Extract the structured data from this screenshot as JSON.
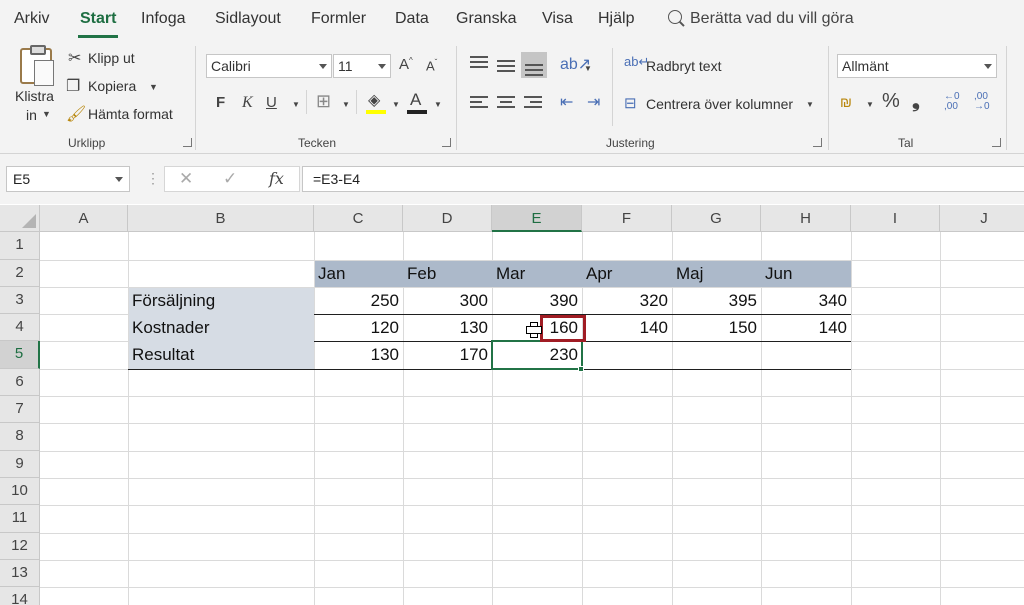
{
  "tabs": [
    "Arkiv",
    "Start",
    "Infoga",
    "Sidlayout",
    "Formler",
    "Data",
    "Granska",
    "Visa",
    "Hjälp"
  ],
  "tell_me": "Berätta vad du vill göra",
  "ribbon": {
    "clipboard": {
      "paste_line1": "Klistra",
      "paste_line2": "in",
      "cut": "Klipp ut",
      "copy": "Kopiera",
      "format_painter": "Hämta format",
      "group": "Urklipp"
    },
    "font": {
      "name": "Calibri",
      "size": "11",
      "bold": "F",
      "italic": "K",
      "underline": "U",
      "group": "Tecken"
    },
    "alignment": {
      "wrap_text": "Radbryt text",
      "merge_center": "Centrera över kolumner",
      "group": "Justering"
    },
    "number": {
      "format": "Allmänt",
      "percent": "%",
      "comma": "❟",
      "group": "Tal"
    }
  },
  "formula_bar": {
    "name_box": "E5",
    "formula": "=E3-E4"
  },
  "sheet": {
    "columns": [
      "A",
      "B",
      "C",
      "D",
      "E",
      "F",
      "G",
      "H",
      "I",
      "J"
    ],
    "rows": [
      "1",
      "2",
      "3",
      "4",
      "5",
      "6",
      "7",
      "8",
      "9",
      "10",
      "11",
      "12",
      "13",
      "14"
    ],
    "months": [
      "Jan",
      "Feb",
      "Mar",
      "Apr",
      "Maj",
      "Jun"
    ],
    "labels": [
      "Försäljning",
      "Kostnader",
      "Resultat"
    ],
    "sales": [
      "250",
      "300",
      "390",
      "320",
      "395",
      "340"
    ],
    "costs": [
      "120",
      "130",
      "160",
      "140",
      "150",
      "140"
    ],
    "result": [
      "130",
      "170",
      "230"
    ],
    "active_cell": "E5",
    "highlighted_cell": "E4"
  },
  "colors": {
    "accent": "#217346",
    "header_fill": "#acb9ca",
    "label_fill": "#d6dce4",
    "highlight": "#a01c24"
  }
}
